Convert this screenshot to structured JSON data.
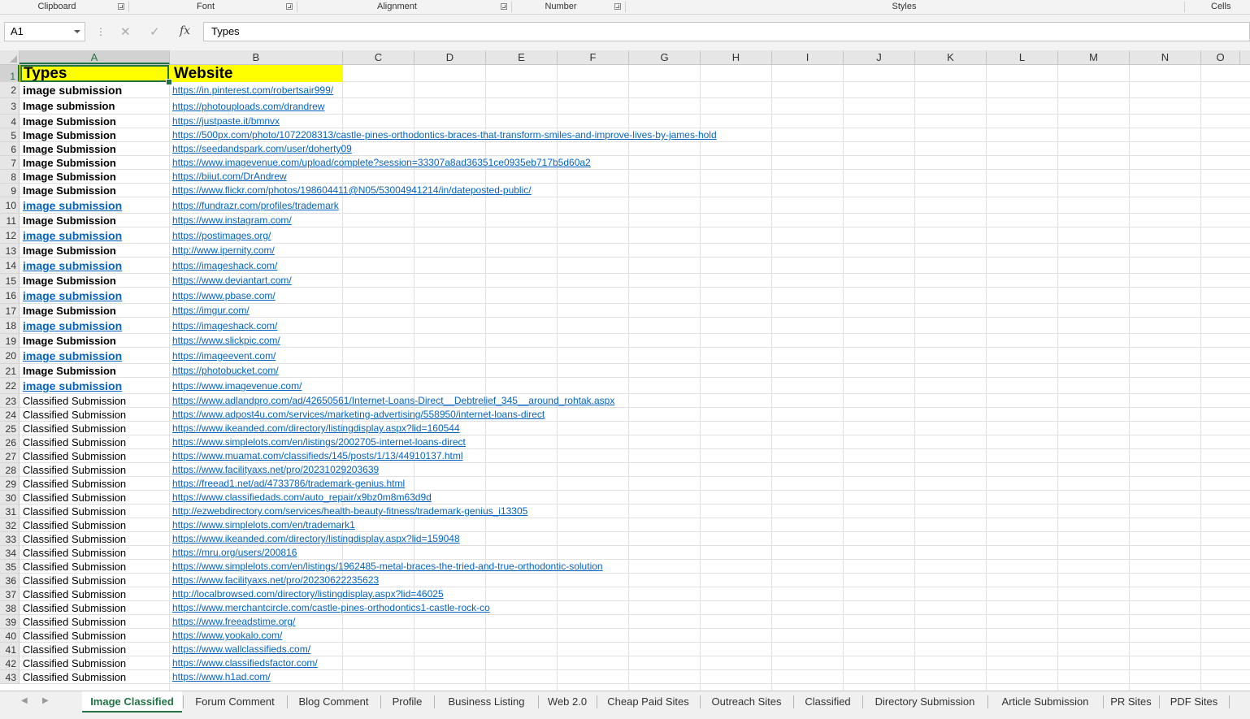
{
  "ribbon": {
    "groups": [
      "Clipboard",
      "Font",
      "Alignment",
      "Number",
      "Styles",
      "Cells"
    ]
  },
  "formula_bar": {
    "name_box": "A1",
    "cancel_icon": "✕",
    "enter_icon": "✓",
    "fx_label": "fx",
    "value": "Types"
  },
  "columns": [
    "A",
    "B",
    "C",
    "D",
    "E",
    "F",
    "G",
    "H",
    "I",
    "J",
    "K",
    "L",
    "M",
    "N",
    "O"
  ],
  "header_row": {
    "a": "Types",
    "b": "Website"
  },
  "rows": [
    {
      "n": "2",
      "a": "image submission",
      "b": "https://in.pinterest.com/robertsair999/"
    },
    {
      "n": "3",
      "a": "Image submission",
      "b": "https://photouploads.com/drandrew"
    },
    {
      "n": "4",
      "a": "Image Submission",
      "b": "https://justpaste.it/bmnvx"
    },
    {
      "n": "5",
      "a": "Image Submission",
      "b": "https://500px.com/photo/1072208313/castle-pines-orthodontics-braces-that-transform-smiles-and-improve-lives-by-james-hold"
    },
    {
      "n": "6",
      "a": "Image Submission",
      "b": "https://seedandspark.com/user/doherty09"
    },
    {
      "n": "7",
      "a": "Image Submission",
      "b": "https://www.imagevenue.com/upload/complete?session=33307a8ad36351ce0935eb717b5d60a2"
    },
    {
      "n": "8",
      "a": "Image Submission",
      "b": "https://biiut.com/DrAndrew"
    },
    {
      "n": "9",
      "a": "Image Submission",
      "b": "https://www.flickr.com/photos/198604411@N05/53004941214/in/dateposted-public/"
    },
    {
      "n": "10",
      "a": "image submission",
      "b": "https://fundrazr.com/profiles/trademark"
    },
    {
      "n": "11",
      "a": "Image Submission",
      "b": "https://www.instagram.com/"
    },
    {
      "n": "12",
      "a": "image submission",
      "b": "https://postimages.org/"
    },
    {
      "n": "13",
      "a": "Image Submission",
      "b": "http://www.ipernity.com/"
    },
    {
      "n": "14",
      "a": "image submission",
      "b": "https://imageshack.com/"
    },
    {
      "n": "15",
      "a": "Image Submission",
      "b": "https://www.deviantart.com/"
    },
    {
      "n": "16",
      "a": "image submission",
      "b": "https://www.pbase.com/"
    },
    {
      "n": "17",
      "a": "Image Submission",
      "b": "https://imgur.com/"
    },
    {
      "n": "18",
      "a": "image submission",
      "b": "https://imageshack.com/"
    },
    {
      "n": "19",
      "a": "Image Submission",
      "b": "https://www.slickpic.com/"
    },
    {
      "n": "20",
      "a": "image submission",
      "b": "https://imageevent.com/"
    },
    {
      "n": "21",
      "a": "Image Submission",
      "b": "https://photobucket.com/"
    },
    {
      "n": "22",
      "a": "image submission",
      "b": "https://www.imagevenue.com/"
    },
    {
      "n": "23",
      "a": "Classified Submission",
      "b": "https://www.adlandpro.com/ad/42650561/Internet-Loans-Direct__Debtrelief_345__around_rohtak.aspx"
    },
    {
      "n": "24",
      "a": "Classified Submission",
      "b": "https://www.adpost4u.com/services/marketing-advertising/558950/internet-loans-direct"
    },
    {
      "n": "25",
      "a": "Classified Submission",
      "b": "https://www.ikeanded.com/directory/listingdisplay.aspx?lid=160544"
    },
    {
      "n": "26",
      "a": "Classified Submission",
      "b": "https://www.simplelots.com/en/listings/2002705-internet-loans-direct"
    },
    {
      "n": "27",
      "a": "Classified Submission",
      "b": "https://www.muamat.com/classifieds/145/posts/1/13/44910137.html"
    },
    {
      "n": "28",
      "a": "Classified Submission",
      "b": "https://www.facilityaxs.net/pro/20231029203639"
    },
    {
      "n": "29",
      "a": "Classified Submission",
      "b": "https://freead1.net/ad/4733786/trademark-genius.html"
    },
    {
      "n": "30",
      "a": "Classified Submission",
      "b": "https://www.classifiedads.com/auto_repair/x9bz0m8m63d9d"
    },
    {
      "n": "31",
      "a": "Classified Submission",
      "b": "http://ezwebdirectory.com/services/health-beauty-fitness/trademark-genius_i13305"
    },
    {
      "n": "32",
      "a": "Classified Submission",
      "b": "https://www.simplelots.com/en/trademark1"
    },
    {
      "n": "33",
      "a": "Classified Submission",
      "b": "https://www.ikeanded.com/directory/listingdisplay.aspx?lid=159048"
    },
    {
      "n": "34",
      "a": "Classified Submission",
      "b": "https://mru.org/users/200816"
    },
    {
      "n": "35",
      "a": "Classified Submission",
      "b": "https://www.simplelots.com/en/listings/1962485-metal-braces-the-tried-and-true-orthodontic-solution"
    },
    {
      "n": "36",
      "a": "Classified Submission",
      "b": "https://www.facilityaxs.net/pro/20230622235623"
    },
    {
      "n": "37",
      "a": "Classified Submission",
      "b": "http://localbrowsed.com/directory/listingdisplay.aspx?lid=46025"
    },
    {
      "n": "38",
      "a": "Classified Submission",
      "b": "https://www.merchantcircle.com/castle-pines-orthodontics1-castle-rock-co"
    },
    {
      "n": "39",
      "a": "Classified Submission",
      "b": "https://www.freeadstime.org/"
    },
    {
      "n": "40",
      "a": "Classified Submission",
      "b": "https://www.yookalo.com/"
    },
    {
      "n": "41",
      "a": "Classified Submission",
      "b": "https://www.wallclassifieds.com/"
    },
    {
      "n": "42",
      "a": "Classified Submission",
      "b": "https://www.classifiedsfactor.com/"
    },
    {
      "n": "43",
      "a": "Classified Submission",
      "b": "https://www.h1ad.com/"
    }
  ],
  "sheet_tabs": [
    "Image Classified",
    "Forum Comment",
    "Blog Comment",
    "Profile",
    "Business Listing",
    "Web 2.0",
    "Cheap Paid Sites",
    "Outreach Sites",
    "Classified",
    "Directory Submission",
    "Article Submission",
    "PR Sites",
    "PDF Sites"
  ],
  "active_tab": "Image Classified",
  "colors": {
    "accent": "#217346",
    "link": "#0563c1",
    "header_fill": "#ffff00"
  }
}
